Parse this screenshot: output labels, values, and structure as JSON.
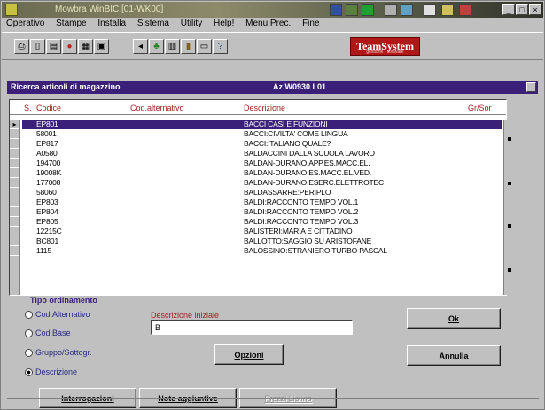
{
  "window": {
    "title": "Mowbra   WinBIC [01-WK00]"
  },
  "menu": [
    "Operativo",
    "Stampe",
    "Installa",
    "Sistema",
    "Utility",
    "Help!",
    "Menu Prec.",
    "Fine"
  ],
  "logo": {
    "main": "TeamSystem",
    "sub": "gestione · software"
  },
  "panel": {
    "title": "Ricerca articoli di magazzino",
    "context": "Az.W0930 L01"
  },
  "grid": {
    "columns": [
      "S.",
      "Codice",
      "Cod.alternativo",
      "Descrizione",
      "Gr/Sor"
    ],
    "rows": [
      {
        "code": "EP801",
        "desc": "BACCI CASI E FUNZIONI",
        "selected": true
      },
      {
        "code": "58001",
        "desc": "BACCI:CIVILTA' COME LINGUA"
      },
      {
        "code": "EP817",
        "desc": "BACCI:ITALIANO QUALE?"
      },
      {
        "code": "A0580",
        "desc": "BALDACCINI DALLA SCUOLA LAVORO"
      },
      {
        "code": "194700",
        "desc": "BALDAN-DURANO:APP.ES.MACC.EL."
      },
      {
        "code": "19008K",
        "desc": "BALDAN-DURANO:ES.MACC.EL.VED."
      },
      {
        "code": "177008",
        "desc": "BALDAN-DURANO:ESERC.ELETTROTEC"
      },
      {
        "code": "58060",
        "desc": "BALDASSARRE:PERIPLO"
      },
      {
        "code": "EP803",
        "desc": "BALDI:RACCONTO TEMPO VOL.1"
      },
      {
        "code": "EP804",
        "desc": "BALDI:RACCONTO TEMPO VOL.2"
      },
      {
        "code": "EP805",
        "desc": "BALDI:RACCONTO TEMPO VOL.3"
      },
      {
        "code": "12215C",
        "desc": "BALISTERI:MARIA E CITTADINO"
      },
      {
        "code": "BC801",
        "desc": "BALLOTTO:SAGGIO SU ARISTOFANE"
      },
      {
        "code": "1115",
        "desc": "BALOSSINO:STRANIERO TURBO PASCAL"
      }
    ]
  },
  "sort": {
    "group_title": "Tipo ordinamento",
    "options": [
      {
        "label": "Cod.Alternativo",
        "checked": false
      },
      {
        "label": "Cod.Base",
        "checked": false
      },
      {
        "label": "Gruppo/Sottogr.",
        "checked": false
      },
      {
        "label": "Descrizione",
        "checked": true
      }
    ]
  },
  "search": {
    "label": "Descrizione iniziale",
    "value": "B"
  },
  "buttons": {
    "ok": "Ok",
    "annulla": "Annulla",
    "opzioni": "Opzioni",
    "interrogazioni": "Interrogazioni",
    "note": "Note aggiuntive",
    "disabled": "Prezzi Listino"
  },
  "colors": {
    "panel_bg": "#3a2079",
    "label_red": "#a32020",
    "logo_red": "#b01818"
  }
}
